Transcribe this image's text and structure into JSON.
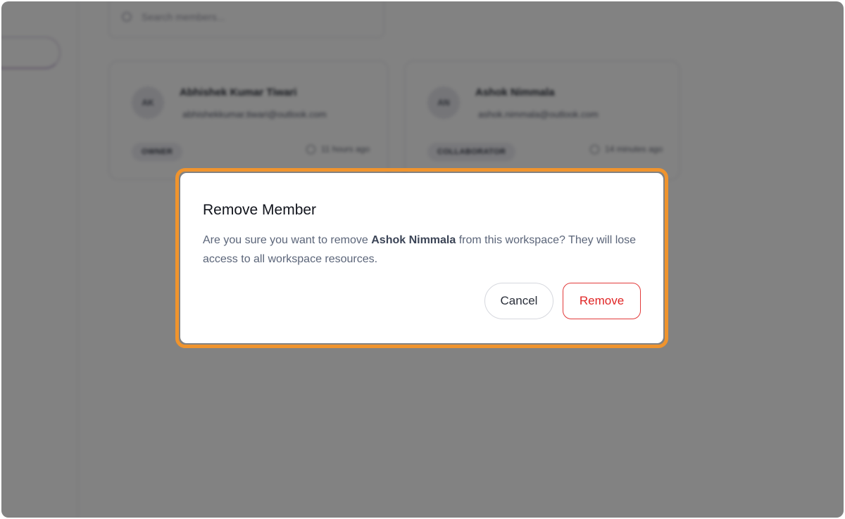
{
  "search": {
    "placeholder": "Search members..."
  },
  "members": [
    {
      "initials": "AK",
      "name": "Abhishek Kumar Tiwari",
      "email": "abhishekkumar.tiwari@outlook.com",
      "role": "OWNER",
      "last_seen": "11 hours ago"
    },
    {
      "initials": "AN",
      "name": "Ashok Nimmala",
      "email": "ashok.nimmala@outlook.com",
      "role": "COLLABORATOR",
      "last_seen": "14 minutes ago"
    }
  ],
  "dialog": {
    "title": "Remove Member",
    "message_prefix": "Are you sure you want to remove ",
    "member_name": "Ashok Nimmala",
    "message_suffix": " from this workspace? They will lose access to all workspace resources.",
    "cancel_label": "Cancel",
    "remove_label": "Remove"
  },
  "colors": {
    "focus_ring": "#f0942d",
    "danger": "#e02424",
    "overlay": "rgba(0,0,0,0.49)"
  },
  "icons": {
    "search": "search-icon",
    "clock": "clock-icon"
  }
}
